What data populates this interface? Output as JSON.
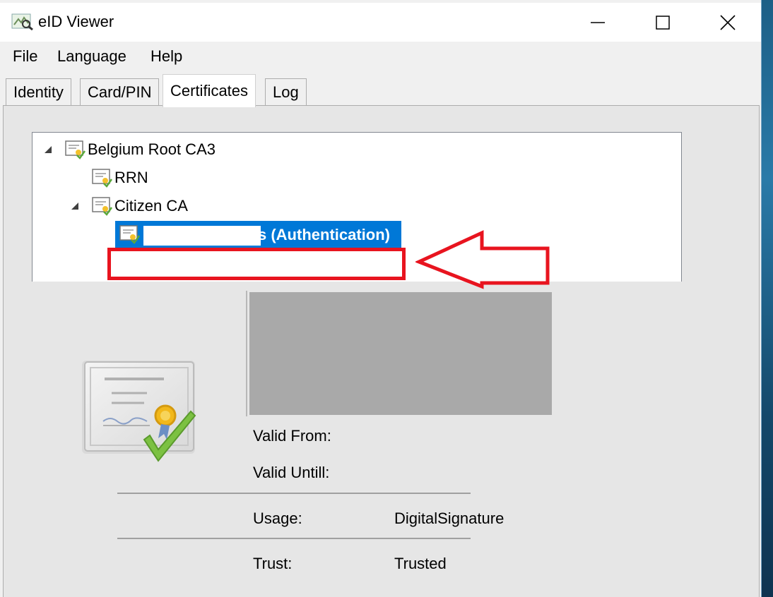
{
  "window": {
    "title": "eID Viewer",
    "controls": {
      "minimize": "—",
      "maximize": "☐",
      "close": "✕"
    }
  },
  "menu": {
    "items": [
      "File",
      "Language",
      "Help"
    ]
  },
  "tabs": [
    {
      "label": "Identity",
      "active": false
    },
    {
      "label": "Card/PIN",
      "active": false
    },
    {
      "label": "Certificates",
      "active": true
    },
    {
      "label": "Log",
      "active": false
    }
  ],
  "tree": {
    "nodes": [
      {
        "label": "Belgium Root CA3",
        "level": 0,
        "expanded": true
      },
      {
        "label": "RRN",
        "level": 1
      },
      {
        "label": "Citizen CA",
        "level": 1,
        "expanded": true
      },
      {
        "label": "s (Authentication)",
        "level": 2,
        "selected": true
      }
    ]
  },
  "details": {
    "valid_from_label": "Valid From:",
    "valid_until_label": "Valid Untill:",
    "usage_label": "Usage:",
    "usage_value": "DigitalSignature",
    "trust_label": "Trust:",
    "trust_value": "Trusted"
  },
  "colors": {
    "selection": "#0078d7",
    "annotation_red": "#e8141f",
    "title_bar": "#ffffff"
  }
}
